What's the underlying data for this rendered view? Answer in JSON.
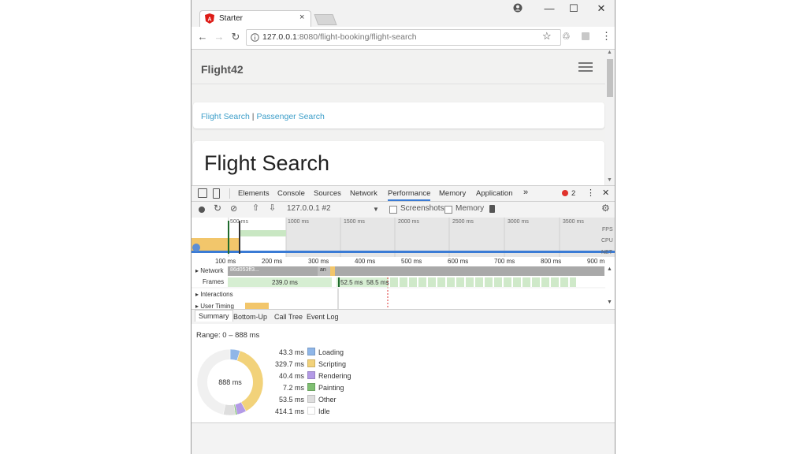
{
  "browser": {
    "tab_title": "Starter",
    "tab_close": "×",
    "url_host": "127.0.0.1",
    "url_rest": ":8080/flight-booking/flight-search",
    "window_controls": [
      "—",
      "☐",
      "✕"
    ],
    "nav_icons": [
      "←",
      "→",
      "↻"
    ]
  },
  "app": {
    "brand": "Flight42",
    "nav_link_flight": "Flight Search",
    "nav_separator": "|",
    "nav_link_passenger": "Passenger Search",
    "heading": "Flight Search"
  },
  "devtools": {
    "tabs": [
      "Elements",
      "Console",
      "Sources",
      "Network",
      "Performance",
      "Memory",
      "Application"
    ],
    "more": "»",
    "error_count": "2",
    "menu": "⋮",
    "close": "✕",
    "profile_select": "127.0.0.1 #2",
    "screenshots_label": "Screenshots",
    "memory_label": "Memory",
    "overview_ticks": [
      "500 ms",
      "1000 ms",
      "1500 ms",
      "2000 ms",
      "2500 ms",
      "3000 ms",
      "3500 ms"
    ],
    "overview_lanes": [
      "FPS",
      "CPU",
      "NET"
    ],
    "ruler_ticks": [
      "100 ms",
      "200 ms",
      "300 ms",
      "400 ms",
      "500 ms",
      "600 ms",
      "700 ms",
      "800 ms",
      "900 m"
    ],
    "tracks": {
      "network": "Network",
      "network_item": "86d053ff3...",
      "network_item2": "an",
      "frames": "Frames",
      "frame_1": "239.0 ms",
      "frame_2": "52.5 ms",
      "frame_3": "58.5 ms",
      "interactions": "Interactions",
      "user_timing": "User Timing"
    },
    "subtabs": [
      "Summary",
      "Bottom-Up",
      "Call Tree",
      "Event Log"
    ],
    "range": "Range: 0 – 888 ms",
    "donut_center": "888 ms",
    "summary": [
      {
        "value": "43.3 ms",
        "label": "Loading",
        "color": "#8fb6e8",
        "ms": 43.3
      },
      {
        "value": "329.7 ms",
        "label": "Scripting",
        "color": "#f2d27a",
        "ms": 329.7
      },
      {
        "value": "40.4 ms",
        "label": "Rendering",
        "color": "#b39ae6",
        "ms": 40.4
      },
      {
        "value": "7.2 ms",
        "label": "Painting",
        "color": "#7fbf72",
        "ms": 7.2
      },
      {
        "value": "53.5 ms",
        "label": "Other",
        "color": "#dedede",
        "ms": 53.5
      },
      {
        "value": "414.1 ms",
        "label": "Idle",
        "color": "#ffffff",
        "ms": 414.1
      }
    ]
  }
}
